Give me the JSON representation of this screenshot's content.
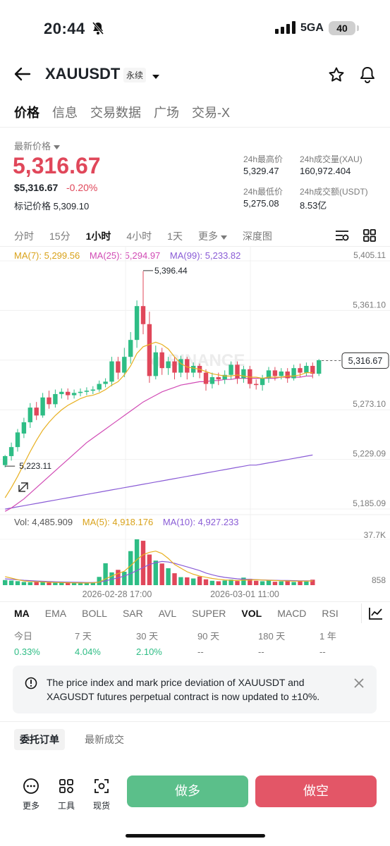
{
  "status_bar": {
    "time": "20:44",
    "network": "5GA",
    "battery": "40"
  },
  "header": {
    "symbol": "XAUUSDT",
    "badge": "永续"
  },
  "tabs": [
    {
      "label": "价格",
      "active": true
    },
    {
      "label": "信息",
      "active": false
    },
    {
      "label": "交易数据",
      "active": false
    },
    {
      "label": "广场",
      "active": false
    },
    {
      "label": "交易-X",
      "active": false
    }
  ],
  "price": {
    "latest_label": "最新价格",
    "last": "5,316.67",
    "usd": "$5,316.67",
    "change": "-0.20%",
    "mark_label": "标记价格",
    "mark": "5,309.10"
  },
  "stats": {
    "high_label": "24h最高价",
    "high": "5,329.47",
    "low_label": "24h最低价",
    "low": "5,275.08",
    "vol_label": "24h成交量(XAU)",
    "vol": "160,972.404",
    "turnover_label": "24h成交额(USDT)",
    "turnover": "8.53亿"
  },
  "intervals": [
    {
      "label": "分时",
      "active": false
    },
    {
      "label": "15分",
      "active": false
    },
    {
      "label": "1小时",
      "active": true
    },
    {
      "label": "4小时",
      "active": false
    },
    {
      "label": "1天",
      "active": false
    },
    {
      "label": "更多",
      "active": false
    },
    {
      "label": "深度图",
      "active": false
    }
  ],
  "ma_legend": {
    "ma7": "MA(7): 5,299.56",
    "ma25": "MA(25): 5,294.97",
    "ma99": "MA(99): 5,233.82"
  },
  "vol_legend": {
    "vol": "Vol: 4,485.909",
    "ma5": "MA(5): 4,918.176",
    "ma10": "MA(10): 4,927.233"
  },
  "colors": {
    "up": "#2ebd85",
    "down": "#e0475a",
    "ma7": "#e8b020",
    "ma25": "#d14bb5",
    "ma99": "#8a5cd6"
  },
  "chart_data": {
    "type": "candlestick",
    "price_axis": [
      "5,405.11",
      "5,361.10",
      "5,316.67",
      "5,273.10",
      "5,229.09",
      "5,185.09"
    ],
    "price_levels": [
      5405.11,
      5361.1,
      5317.1,
      5273.1,
      5229.09,
      5185.09
    ],
    "high_label": "5,396.44",
    "low_label": "5,223.11",
    "current_price_label": "5,316.67",
    "current_price": 5316.67,
    "volume_axis": [
      "37.7K",
      "858"
    ],
    "volume_axis_values": [
      37700,
      858
    ],
    "time_labels": [
      "2026-02-28 17:00",
      "2026-03-01 11:00"
    ],
    "watermark": "BINANCE",
    "candles": [
      [
        5224,
        5232,
        5222,
        5233,
        "up"
      ],
      [
        5232,
        5240,
        5228,
        5244,
        "up"
      ],
      [
        5240,
        5253,
        5236,
        5256,
        "up"
      ],
      [
        5252,
        5262,
        5248,
        5266,
        "up"
      ],
      [
        5262,
        5275,
        5257,
        5279,
        "up"
      ],
      [
        5275,
        5268,
        5264,
        5280,
        "down"
      ],
      [
        5268,
        5284,
        5266,
        5288,
        "up"
      ],
      [
        5284,
        5278,
        5274,
        5290,
        "down"
      ],
      [
        5278,
        5287,
        5275,
        5291,
        "up"
      ],
      [
        5287,
        5289,
        5283,
        5292,
        "up"
      ],
      [
        5289,
        5286,
        5282,
        5292,
        "down"
      ],
      [
        5286,
        5288,
        5283,
        5291,
        "up"
      ],
      [
        5288,
        5289,
        5285,
        5292,
        "up"
      ],
      [
        5289,
        5290,
        5286,
        5293,
        "up"
      ],
      [
        5290,
        5291,
        5287,
        5294,
        "up"
      ],
      [
        5291,
        5296,
        5289,
        5299,
        "up"
      ],
      [
        5296,
        5298,
        5293,
        5301,
        "up"
      ],
      [
        5298,
        5316,
        5294,
        5320,
        "up"
      ],
      [
        5316,
        5306,
        5300,
        5320,
        "down"
      ],
      [
        5306,
        5320,
        5302,
        5328,
        "up"
      ],
      [
        5320,
        5335,
        5314,
        5342,
        "up"
      ],
      [
        5335,
        5365,
        5328,
        5370,
        "up"
      ],
      [
        5365,
        5349,
        5340,
        5396,
        "down"
      ],
      [
        5349,
        5303,
        5297,
        5360,
        "down"
      ],
      [
        5303,
        5324,
        5300,
        5330,
        "up"
      ],
      [
        5324,
        5310,
        5304,
        5328,
        "down"
      ],
      [
        5310,
        5316,
        5304,
        5320,
        "up"
      ],
      [
        5316,
        5306,
        5300,
        5320,
        "down"
      ],
      [
        5306,
        5318,
        5302,
        5321,
        "up"
      ],
      [
        5318,
        5306,
        5300,
        5320,
        "down"
      ],
      [
        5306,
        5312,
        5302,
        5315,
        "up"
      ],
      [
        5312,
        5306,
        5301,
        5314,
        "down"
      ],
      [
        5306,
        5296,
        5290,
        5309,
        "down"
      ],
      [
        5296,
        5302,
        5292,
        5306,
        "up"
      ],
      [
        5302,
        5300,
        5295,
        5306,
        "down"
      ],
      [
        5300,
        5304,
        5296,
        5308,
        "up"
      ],
      [
        5304,
        5313,
        5300,
        5316,
        "up"
      ],
      [
        5313,
        5301,
        5296,
        5316,
        "down"
      ],
      [
        5301,
        5309,
        5297,
        5312,
        "up"
      ],
      [
        5309,
        5296,
        5292,
        5312,
        "down"
      ],
      [
        5296,
        5295,
        5291,
        5300,
        "down"
      ],
      [
        5295,
        5301,
        5290,
        5304,
        "up"
      ],
      [
        5301,
        5308,
        5297,
        5311,
        "up"
      ],
      [
        5308,
        5303,
        5299,
        5311,
        "down"
      ],
      [
        5303,
        5307,
        5300,
        5310,
        "up"
      ],
      [
        5307,
        5301,
        5297,
        5310,
        "down"
      ],
      [
        5301,
        5310,
        5299,
        5313,
        "up"
      ],
      [
        5310,
        5306,
        5302,
        5314,
        "down"
      ],
      [
        5306,
        5312,
        5303,
        5315,
        "up"
      ],
      [
        5312,
        5305,
        5301,
        5315,
        "down"
      ],
      [
        5305,
        5317,
        5303,
        5318,
        "up"
      ]
    ],
    "volumes": [
      4200,
      3800,
      3300,
      2600,
      2400,
      2600,
      2500,
      2300,
      2000,
      2100,
      1800,
      1700,
      1600,
      1800,
      2000,
      6800,
      18000,
      10500,
      12600,
      11000,
      28000,
      37700,
      36500,
      25200,
      20200,
      17800,
      13900,
      9800,
      6600,
      6400,
      5500,
      7100,
      4800,
      3600,
      3200,
      3800,
      4600,
      3400,
      6200,
      5200,
      3600,
      3200,
      3900,
      2800,
      3100,
      3300,
      2600,
      3600,
      3000,
      4500
    ],
    "ma7": [
      5195,
      5204,
      5214,
      5225,
      5236,
      5246,
      5255,
      5262,
      5268,
      5273,
      5277,
      5280,
      5283,
      5285,
      5286,
      5288,
      5291,
      5295,
      5298,
      5304,
      5312,
      5323,
      5329,
      5331,
      5333,
      5331,
      5327,
      5320,
      5314,
      5311,
      5310,
      5309,
      5307,
      5305,
      5304,
      5303,
      5303,
      5304,
      5303,
      5302,
      5302,
      5301,
      5302,
      5302,
      5302,
      5303,
      5303,
      5304,
      5306,
      5306
    ],
    "ma25": [
      5183,
      5186,
      5190,
      5194,
      5199,
      5204,
      5209,
      5214,
      5219,
      5224,
      5229,
      5234,
      5239,
      5244,
      5248,
      5252,
      5256,
      5260,
      5264,
      5268,
      5272,
      5276,
      5280,
      5283,
      5286,
      5289,
      5291,
      5293,
      5295,
      5296,
      5297,
      5298,
      5298,
      5299,
      5299,
      5300,
      5300,
      5301,
      5301,
      5301,
      5301,
      5301,
      5301,
      5301,
      5302,
      5302,
      5302,
      5302,
      5303,
      5303
    ],
    "ma99": [
      5185,
      5186,
      5187,
      5188,
      5189,
      5190,
      5191,
      5192,
      5193,
      5194,
      5195,
      5196,
      5197,
      5198,
      5199,
      5200,
      5201,
      5202,
      5203,
      5204,
      5205,
      5206,
      5207,
      5208,
      5209,
      5210,
      5211,
      5212,
      5213,
      5214,
      5215,
      5216,
      5217,
      5218,
      5219,
      5220,
      5221,
      5222,
      5223,
      5224,
      5224,
      5225,
      5226,
      5227,
      5228,
      5229,
      5230,
      5231,
      5232,
      5233
    ],
    "vol_ma5": [
      7000,
      5800,
      4500,
      3500,
      3000,
      2800,
      2600,
      2400,
      2200,
      2100,
      2000,
      1900,
      1800,
      1800,
      1900,
      2500,
      5200,
      7500,
      9500,
      11500,
      16000,
      21000,
      25000,
      27000,
      28000,
      26000,
      22000,
      17000,
      14000,
      11000,
      9000,
      7500,
      6500,
      5500,
      4800,
      4300,
      4000,
      3800,
      4100,
      4300,
      4400,
      4200,
      4000,
      3800,
      3600,
      3400,
      3300,
      3300,
      3300,
      3500
    ],
    "vol_ma10": [
      5200,
      4800,
      4400,
      4000,
      3700,
      3400,
      3200,
      3000,
      2800,
      2600,
      2500,
      2400,
      2300,
      2200,
      2200,
      2500,
      3500,
      4800,
      6000,
      7500,
      9500,
      12000,
      14500,
      17000,
      18500,
      19500,
      19000,
      18000,
      16500,
      15000,
      13500,
      12000,
      10000,
      8500,
      7300,
      6400,
      5800,
      5200,
      4900,
      4700,
      4500,
      4300,
      4100,
      4000,
      3900,
      3800,
      3700,
      3600,
      3600,
      3600
    ]
  },
  "indicators": [
    {
      "label": "MA",
      "active": true
    },
    {
      "label": "EMA",
      "active": false
    },
    {
      "label": "BOLL",
      "active": false
    },
    {
      "label": "SAR",
      "active": false
    },
    {
      "label": "AVL",
      "active": false
    },
    {
      "label": "SUPER",
      "active": false
    },
    {
      "label": "VOL",
      "active": true
    },
    {
      "label": "MACD",
      "active": false
    },
    {
      "label": "RSI",
      "active": false
    }
  ],
  "performance": [
    {
      "label": "今日",
      "value": "0.33%",
      "positive": true
    },
    {
      "label": "7 天",
      "value": "4.04%",
      "positive": true
    },
    {
      "label": "30 天",
      "value": "2.10%",
      "positive": true
    },
    {
      "label": "90 天",
      "value": "--",
      "positive": false
    },
    {
      "label": "180 天",
      "value": "--",
      "positive": false
    },
    {
      "label": "1 年",
      "value": "--",
      "positive": false
    }
  ],
  "notice": {
    "text": "The price index and mark price deviation of XAUUSDT and XAGUSDT futures perpetual contract is now updated to ±10%."
  },
  "bottom_tabs": {
    "orders": "委托订单",
    "trades": "最新成交"
  },
  "toolbar": {
    "more": "更多",
    "tools": "工具",
    "spot": "现货",
    "long": "做多",
    "short": "做空"
  }
}
